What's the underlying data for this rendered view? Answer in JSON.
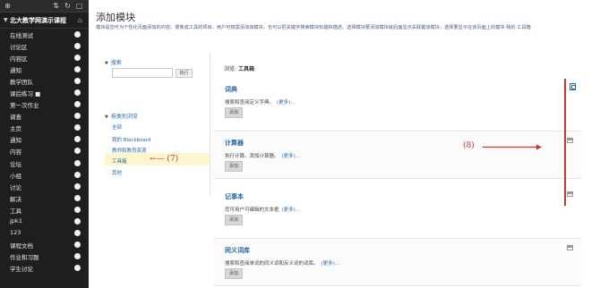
{
  "sidebar": {
    "course_title": "北大教学网演示课程",
    "items": [
      {
        "label": "在线测试"
      },
      {
        "label": "讨论区"
      },
      {
        "label": "内容区"
      },
      {
        "label": "通知"
      },
      {
        "label": "教学团队"
      },
      {
        "label": "课后练习 ■"
      },
      {
        "label": "第一次作业"
      },
      {
        "label": "调查"
      },
      {
        "label": "主页"
      },
      {
        "label": "通知"
      },
      {
        "label": "内容"
      },
      {
        "label": "论坛"
      },
      {
        "label": "小组"
      },
      {
        "label": "讨论"
      },
      {
        "label": "解决"
      },
      {
        "label": "工具"
      },
      {
        "label": "jpk1"
      },
      {
        "label": "123"
      },
      {
        "label": "课程文档"
      },
      {
        "label": "作业和习题"
      },
      {
        "label": "学生讨论"
      }
    ]
  },
  "main": {
    "title": "添加模块",
    "description": "模块是您可为个性化页面添加的内容。很像成工具的项目，用户可按需添加该模块，也可以把关键字搜索模块标题和描述。选择模块要添加模块就后面显示关联键该模块，选择要显示在该页面上的模块 我的 工具箱"
  },
  "search": {
    "heading": "搜索",
    "input_value": "",
    "button_label": "执行"
  },
  "categories": {
    "heading": "按类别浏览",
    "items": [
      "全部",
      "我的 Blackboard",
      "教师和教员资源",
      "工具箱",
      "其他"
    ],
    "selected_index": 3
  },
  "annotations": {
    "arrow7": "←— (7)",
    "label8": "(8)"
  },
  "browse": {
    "prefix": "浏览:",
    "value": "工具箱"
  },
  "modules": [
    {
      "title": "词典",
      "desc": "搜索和查阅定义字典。",
      "more": "(更多)…",
      "add": "添加"
    },
    {
      "title": "计算器",
      "desc": "执行计算。添加计算器。",
      "more": "(更多)…",
      "add": "添加"
    },
    {
      "title": "记事本",
      "desc": "您可用户可编辑的文本框",
      "more": "(更多)…",
      "add": "添加"
    },
    {
      "title": "同义词库",
      "desc": "搜索和查阅单词的同义词和反义词的词库。",
      "more": "(更多)…",
      "add": "添加"
    }
  ],
  "colors": {
    "sidebar_bg": "#1e1e1e",
    "link": "#2a6aa8",
    "highlight": "#fdf6cf",
    "annotation_red": "#c0392b"
  }
}
